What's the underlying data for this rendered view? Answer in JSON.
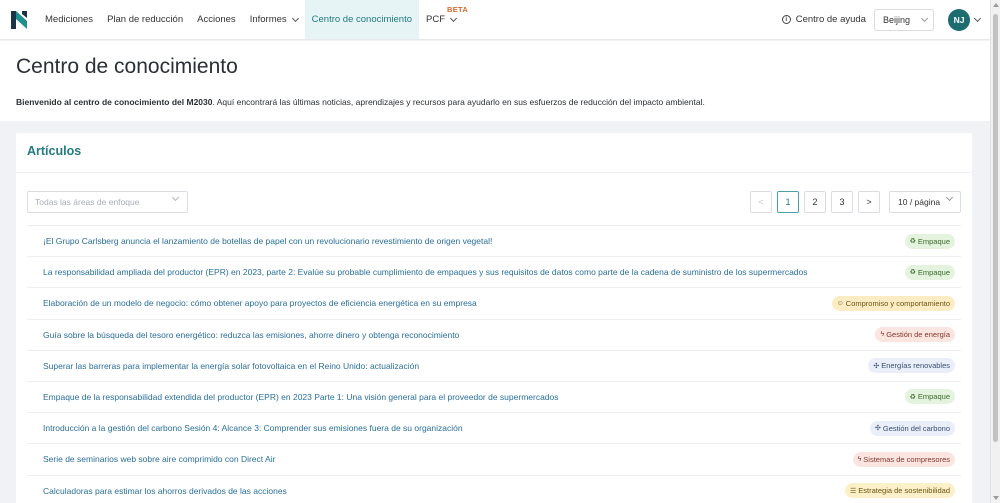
{
  "nav": {
    "items": [
      {
        "label": "Mediciones",
        "name": "nav-mediciones",
        "active": false,
        "dropdown": false
      },
      {
        "label": "Plan de reducción",
        "name": "nav-plan-de-reduccion",
        "active": false,
        "dropdown": false
      },
      {
        "label": "Acciones",
        "name": "nav-acciones",
        "active": false,
        "dropdown": false
      },
      {
        "label": "Informes",
        "name": "nav-informes",
        "active": false,
        "dropdown": true
      },
      {
        "label": "Centro de conocimiento",
        "name": "nav-centro-de-conocimiento",
        "active": true,
        "dropdown": false
      },
      {
        "label": "PCF",
        "name": "nav-pcf",
        "active": false,
        "dropdown": true,
        "badge": "BETA"
      }
    ],
    "help_label": "Centro de ayuda",
    "city": "Beijing",
    "avatar_initials": "NJ"
  },
  "header": {
    "title": "Centro de conocimiento",
    "welcome_bold": "Bienvenido al centro de conocimiento del M2030",
    "welcome_rest": ". Aquí encontrará las últimas noticias, aprendizajes y recursos para ayudarlo en sus esfuerzos de reducción del impacto ambiental."
  },
  "articles": {
    "title": "Artículos",
    "filter_placeholder": "Todas las áreas de enfoque",
    "pagination": {
      "prev": "<",
      "pages": [
        "1",
        "2",
        "3"
      ],
      "current": "1",
      "next": ">",
      "page_size": "10 / página"
    },
    "rows": [
      {
        "title": "¡El Grupo Carlsberg anuncia el lanzamiento de botellas de papel con un revolucionario revestimiento de origen vegetal!",
        "tag": "Empaque",
        "tag_icon": "♻",
        "tag_class": "empaque",
        "tag_icon_name": "recycle-icon"
      },
      {
        "title": "La responsabilidad ampliada del productor (EPR) en 2023, parte 2: Evalúe su probable cumplimiento de empaques y sus requisitos de datos como parte de la cadena de suministro de los supermercados",
        "tag": "Empaque",
        "tag_icon": "♻",
        "tag_class": "empaque",
        "tag_icon_name": "recycle-icon"
      },
      {
        "title": "Elaboración de un modelo de negocio: cómo obtener apoyo para proyectos de eficiencia energética en su empresa",
        "tag": "Compromiso y comportamiento",
        "tag_icon": "☺",
        "tag_class": "compromiso",
        "tag_icon_name": "people-icon"
      },
      {
        "title": "Guía sobre la búsqueda del tesoro energético: reduzca las emisiones, ahorre dinero y obtenga reconocimiento",
        "tag": "Gestión de energía",
        "tag_icon": "ϟ",
        "tag_class": "gestion-energia",
        "tag_icon_name": "lightning-icon"
      },
      {
        "title": "Superar las barreras para implementar la energía solar fotovoltaica en el Reino Unido: actualización",
        "tag": "Energías renovables",
        "tag_icon": "✣",
        "tag_class": "renovables",
        "tag_icon_name": "turbine-icon"
      },
      {
        "title": "Empaque de la responsabilidad extendida del productor (EPR) en 2023 Parte 1: Una visión general para el proveedor de supermercados",
        "tag": "Empaque",
        "tag_icon": "♻",
        "tag_class": "empaque",
        "tag_icon_name": "recycle-icon"
      },
      {
        "title": "Introducción a la gestión del carbono Sesión 4: Alcance 3: Comprender sus emisiones fuera de su organización",
        "tag": "Gestión del carbono",
        "tag_icon": "✣",
        "tag_class": "carbono",
        "tag_icon_name": "molecule-icon"
      },
      {
        "title": "Serie de seminarios web sobre aire comprimido con Direct Air",
        "tag": "Sistemas de compresores",
        "tag_icon": "ϟ",
        "tag_class": "compresores",
        "tag_icon_name": "lightning-icon"
      },
      {
        "title": "Calculadoras para estimar los ahorros derivados de las acciones",
        "tag": "Estrategia de sostenibilidad",
        "tag_icon": "☰",
        "tag_class": "sostenibilidad",
        "tag_icon_name": "strategy-icon"
      }
    ]
  },
  "colors": {
    "brand": "#1f7a80",
    "link": "#2a6f9b",
    "beta": "#d5682b",
    "avatar": "#1c6d71"
  }
}
